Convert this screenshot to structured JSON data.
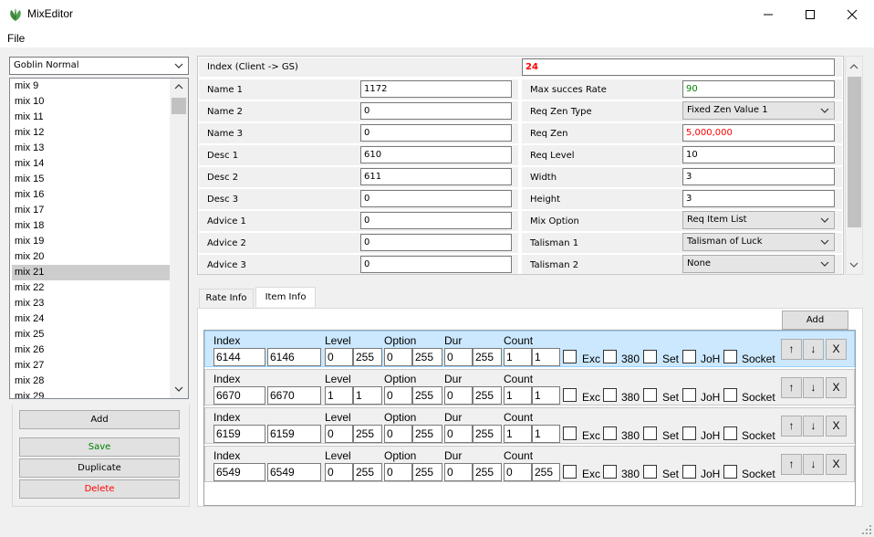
{
  "window": {
    "title": "MixEditor"
  },
  "menu": {
    "file": "File"
  },
  "left": {
    "mix_combo": "Goblin Normal",
    "items": [
      "mix 9",
      "mix 10",
      "mix 11",
      "mix 12",
      "mix 13",
      "mix 14",
      "mix 15",
      "mix 16",
      "mix 17",
      "mix 18",
      "mix 19",
      "mix 20",
      "mix 21",
      "mix 22",
      "mix 23",
      "mix 24",
      "mix 25",
      "mix 26",
      "mix 27",
      "mix 28",
      "mix 29"
    ],
    "selected": "mix 21",
    "add": "Add",
    "save": "Save",
    "duplicate": "Duplicate",
    "delete": "Delete"
  },
  "colors": {
    "save": "#008000",
    "delete": "#ff0000",
    "index_value": "#ff0000",
    "succ_value": "#008000",
    "zen_value": "#ff0000"
  },
  "grid": {
    "index_label": "Index (Client -> GS)",
    "index_value": "24",
    "left": [
      {
        "label": "Name 1",
        "value": "1172"
      },
      {
        "label": "Name 2",
        "value": "0"
      },
      {
        "label": "Name 3",
        "value": "0"
      },
      {
        "label": "Desc 1",
        "value": "610"
      },
      {
        "label": "Desc 2",
        "value": "611"
      },
      {
        "label": "Desc 3",
        "value": "0"
      },
      {
        "label": "Advice 1",
        "value": "0"
      },
      {
        "label": "Advice 2",
        "value": "0"
      },
      {
        "label": "Advice 3",
        "value": "0"
      }
    ],
    "right": [
      {
        "label": "Max succes Rate",
        "value": "90",
        "combo": false
      },
      {
        "label": "Req Zen Type",
        "value": "Fixed Zen Value 1",
        "combo": true
      },
      {
        "label": "Req Zen",
        "value": "5,000,000",
        "combo": false
      },
      {
        "label": "Req Level",
        "value": "10",
        "combo": false
      },
      {
        "label": "Width",
        "value": "3",
        "combo": false
      },
      {
        "label": "Height",
        "value": "3",
        "combo": false
      },
      {
        "label": "Mix Option",
        "value": "Req Item List",
        "combo": true
      },
      {
        "label": "Talisman 1",
        "value": "Talisman of Luck",
        "combo": true
      },
      {
        "label": "Talisman 2",
        "value": "None",
        "combo": true
      }
    ]
  },
  "tabs": [
    {
      "label": "Rate Info"
    },
    {
      "label": "Item Info"
    }
  ],
  "items_panel": {
    "add": "Add",
    "labels": {
      "index": "Index",
      "level": "Level",
      "option": "Option",
      "dur": "Dur",
      "count": "Count",
      "exc": "Exc",
      "v380": "380",
      "set": "Set",
      "joh": "JoH",
      "socket": "Socket"
    },
    "buttons": {
      "up": "↑",
      "down": "↓",
      "remove": "X"
    },
    "rows": [
      {
        "index_from": "6144",
        "index_to": "6146",
        "level_min": "0",
        "level_max": "255",
        "option_min": "0",
        "option_max": "255",
        "dur_min": "0",
        "dur_max": "255",
        "count_min": "1",
        "count_max": "1",
        "selected": true
      },
      {
        "index_from": "6670",
        "index_to": "6670",
        "level_min": "1",
        "level_max": "1",
        "option_min": "0",
        "option_max": "255",
        "dur_min": "0",
        "dur_max": "255",
        "count_min": "1",
        "count_max": "1",
        "selected": false
      },
      {
        "index_from": "6159",
        "index_to": "6159",
        "level_min": "0",
        "level_max": "255",
        "option_min": "0",
        "option_max": "255",
        "dur_min": "0",
        "dur_max": "255",
        "count_min": "1",
        "count_max": "1",
        "selected": false
      },
      {
        "index_from": "6549",
        "index_to": "6549",
        "level_min": "0",
        "level_max": "255",
        "option_min": "0",
        "option_max": "255",
        "dur_min": "0",
        "dur_max": "255",
        "count_min": "0",
        "count_max": "255",
        "selected": false
      }
    ]
  }
}
